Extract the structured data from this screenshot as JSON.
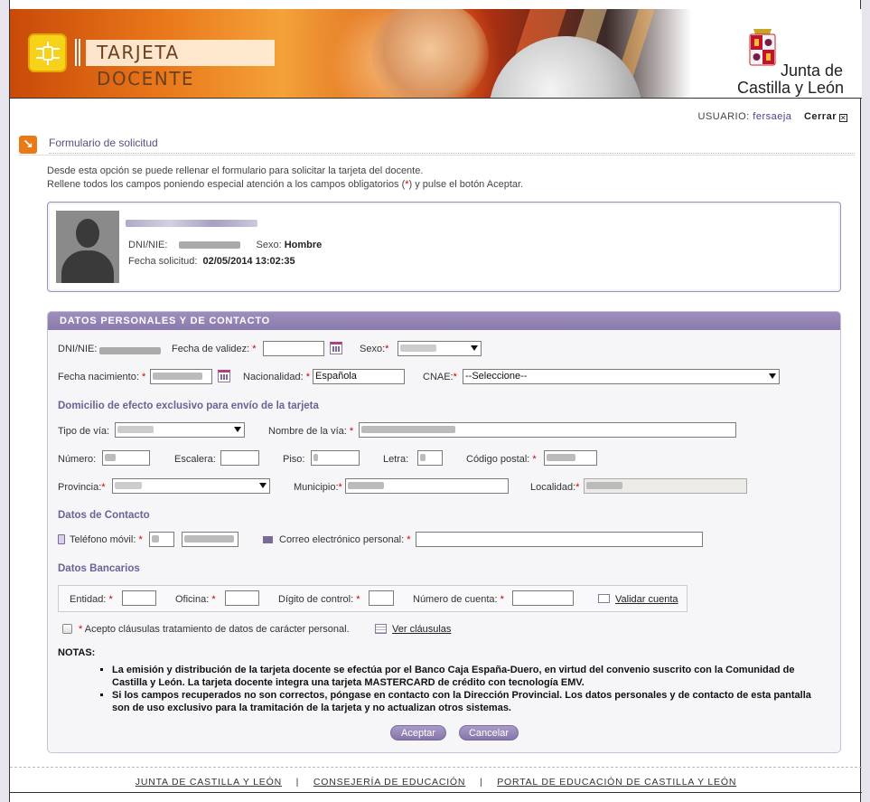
{
  "header": {
    "brand": "TARJETA DOCENTE",
    "org_line1": "Junta de",
    "org_line2": "Castilla y León"
  },
  "user": {
    "label": "USUARIO:",
    "name": "fersaeja",
    "close": "Cerrar"
  },
  "section": {
    "title": "Formulario de solicitud",
    "intro_line1": "Desde esta opción se puede rellenar el formulario para solicitar la tarjeta del docente.",
    "intro_line2_a": "Rellene todos los campos poniendo especial atención a los campos obligatorios (",
    "intro_line2_star": "*",
    "intro_line2_b": ") y pulse el botón Aceptar."
  },
  "profile": {
    "dni_label": "DNI/NIE:",
    "sexo_label": "Sexo:",
    "sexo_value": "Hombre",
    "fecha_label": "Fecha solicitud:",
    "fecha_value": "02/05/2014 13:02:35"
  },
  "form": {
    "panel_title": "DATOS PERSONALES Y DE CONTACTO",
    "dni_label": "DNI/NIE:",
    "validez_label": "Fecha de validez:",
    "sexo_label": "Sexo:",
    "nacimiento_label": "Fecha nacimiento:",
    "nacionalidad_label": "Nacionalidad:",
    "nacionalidad_value": "Española",
    "cnae_label": "CNAE:",
    "cnae_value": "--Seleccione--",
    "domicilio_heading": "Domicilio de efecto exclusivo para envío de la tarjeta",
    "tipo_via_label": "Tipo de vía:",
    "nombre_via_label": "Nombre de la vía:",
    "numero_label": "Número:",
    "escalera_label": "Escalera:",
    "piso_label": "Piso:",
    "letra_label": "Letra:",
    "cp_label": "Código postal:",
    "provincia_label": "Provincia:",
    "municipio_label": "Municipio:",
    "localidad_label": "Localidad:",
    "contacto_heading": "Datos de Contacto",
    "telefono_label": "Teléfono móvil:",
    "correo_label": "Correo electrónico personal:",
    "bancarios_heading": "Datos Bancarios",
    "entidad_label": "Entidad:",
    "oficina_label": "Oficina:",
    "digito_label": "Dígito de control:",
    "cuenta_label": "Número de cuenta:",
    "validar_label": "Validar cuenta",
    "acepto_label": "Acepto cláusulas tratamiento de datos de carácter personal.",
    "ver_clausulas": "Ver cláusulas",
    "req": "*"
  },
  "notes": {
    "heading": "NOTAS:",
    "items": [
      "La emisión y distribución de la tarjeta docente se efectúa por el Banco Caja España-Duero, en virtud del convenio suscrito con la Comunidad de Castilla y León. La tarjeta docente integra una tarjeta MASTERCARD de crédito con tecnología EMV.",
      "Si los campos recuperados no son correctos, póngase en contacto con la Dirección Provincial. Los datos personales y de contacto de esta pantalla son de uso exclusivo para la tramitación de la tarjeta y no actualizan otros sistemas."
    ]
  },
  "buttons": {
    "aceptar": "Aceptar",
    "cancelar": "Cancelar"
  },
  "footer": {
    "link1": "JUNTA DE CASTILLA Y LEÓN",
    "link2": "CONSEJERÍA DE EDUCACIÓN",
    "link3": "PORTAL DE EDUCACIÓN DE CASTILLA Y LEÓN",
    "sep": "|"
  },
  "colors": {
    "accent": "#8a7aad",
    "heading": "#6d6196",
    "required": "#cc0000",
    "banner_orange": "#e9781a"
  }
}
